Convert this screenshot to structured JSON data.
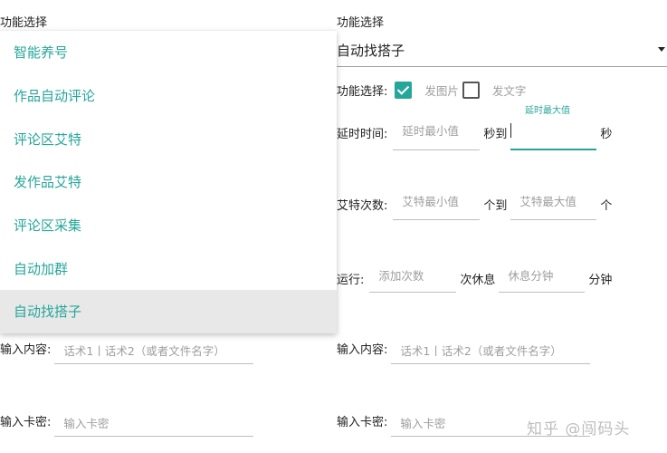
{
  "left": {
    "section_label": "功能选择",
    "menu_items": [
      {
        "label": "智能养号",
        "selected": false
      },
      {
        "label": "作品自动评论",
        "selected": false
      },
      {
        "label": "评论区艾特",
        "selected": false
      },
      {
        "label": "发作品艾特",
        "selected": false
      },
      {
        "label": "评论区采集",
        "selected": false
      },
      {
        "label": "自动加群",
        "selected": false
      },
      {
        "label": "自动找搭子",
        "selected": true
      }
    ],
    "input_content": {
      "label": "输入内容:",
      "placeholder": "话术1丨话术2（或者文件名字）"
    },
    "input_card": {
      "label": "输入卡密:",
      "placeholder": "输入卡密"
    }
  },
  "right": {
    "section_label": "功能选择",
    "dropdown_value": "自动找搭子",
    "func_select": {
      "label": "功能选择:",
      "options": [
        {
          "label": "发图片",
          "checked": true
        },
        {
          "label": "发文字",
          "checked": false
        }
      ]
    },
    "delay": {
      "label": "延时时间:",
      "min_placeholder": "延时最小值",
      "to_label": "秒到",
      "max_floating_label": "延时最大值",
      "unit": "秒"
    },
    "at_count": {
      "label": "艾特次数:",
      "min_placeholder": "艾特最小值",
      "to_label": "个到",
      "max_placeholder": "艾特最大值",
      "unit": "个"
    },
    "run": {
      "label": "运行:",
      "count_placeholder": "添加次数",
      "rest_label": "次休息",
      "rest_placeholder": "休息分钟",
      "unit": "分钟"
    },
    "input_content": {
      "label": "输入内容:",
      "placeholder": "话术1丨话术2（或者文件名字）"
    },
    "input_card": {
      "label": "输入卡密:",
      "placeholder": "输入卡密"
    }
  },
  "watermark": "知乎 @闯码头",
  "colors": {
    "accent": "#26a69a",
    "selected_bg": "#e8e8e8"
  }
}
